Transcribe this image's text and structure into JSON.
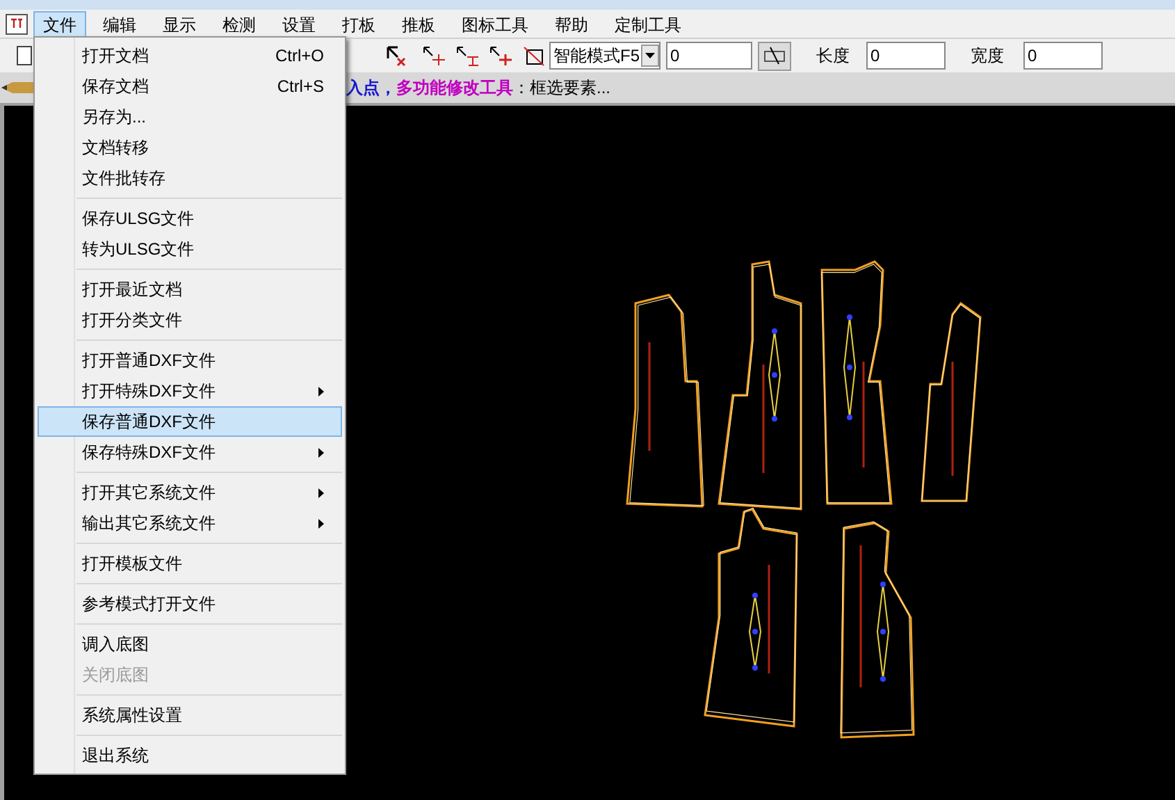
{
  "menu_bar": [
    {
      "label": "文件",
      "selected": true
    },
    {
      "label": "编辑",
      "selected": false
    },
    {
      "label": "显示",
      "selected": false
    },
    {
      "label": "检测",
      "selected": false
    },
    {
      "label": "设置",
      "selected": false
    },
    {
      "label": "打板",
      "selected": false
    },
    {
      "label": "推板",
      "selected": false
    },
    {
      "label": "图标工具",
      "selected": false
    },
    {
      "label": "帮助",
      "selected": false
    },
    {
      "label": "定制工具",
      "selected": false
    }
  ],
  "toolbar": {
    "mode_dropdown": "智能模式F5",
    "value_field": "0",
    "length_label": "长度",
    "length_field": "0",
    "width_label": "宽度",
    "width_field": "0"
  },
  "prompt_bar": [
    {
      "text": "入点，",
      "color": "#1a1ad0"
    },
    {
      "text": "多功能修改工具",
      "color": "#c000c0"
    },
    {
      "text": "：框选要素...",
      "color": "#000000"
    }
  ],
  "file_menu": [
    [
      {
        "label": "打开文档",
        "shortcut": "Ctrl+O",
        "submenu": false,
        "disabled": false,
        "selected": false
      },
      {
        "label": "保存文档",
        "shortcut": "Ctrl+S",
        "submenu": false,
        "disabled": false,
        "selected": false
      },
      {
        "label": "另存为...",
        "submenu": false,
        "disabled": false,
        "selected": false
      },
      {
        "label": "文档转移",
        "submenu": false,
        "disabled": false,
        "selected": false
      },
      {
        "label": "文件批转存",
        "submenu": false,
        "disabled": false,
        "selected": false
      }
    ],
    [
      {
        "label": "保存ULSG文件",
        "submenu": false,
        "disabled": false,
        "selected": false
      },
      {
        "label": "转为ULSG文件",
        "submenu": false,
        "disabled": false,
        "selected": false
      }
    ],
    [
      {
        "label": "打开最近文档",
        "submenu": false,
        "disabled": false,
        "selected": false
      },
      {
        "label": "打开分类文件",
        "submenu": false,
        "disabled": false,
        "selected": false
      }
    ],
    [
      {
        "label": "打开普通DXF文件",
        "submenu": false,
        "disabled": false,
        "selected": false
      },
      {
        "label": "打开特殊DXF文件",
        "submenu": true,
        "disabled": false,
        "selected": false
      },
      {
        "label": "保存普通DXF文件",
        "submenu": false,
        "disabled": false,
        "selected": true
      },
      {
        "label": "保存特殊DXF文件",
        "submenu": true,
        "disabled": false,
        "selected": false
      }
    ],
    [
      {
        "label": "打开其它系统文件",
        "submenu": true,
        "disabled": false,
        "selected": false
      },
      {
        "label": "输出其它系统文件",
        "submenu": true,
        "disabled": false,
        "selected": false
      }
    ],
    [
      {
        "label": "打开模板文件",
        "submenu": false,
        "disabled": false,
        "selected": false
      }
    ],
    [
      {
        "label": "参考模式打开文件",
        "submenu": false,
        "disabled": false,
        "selected": false
      }
    ],
    [
      {
        "label": "调入底图",
        "submenu": false,
        "disabled": false,
        "selected": false
      },
      {
        "label": "关闭底图",
        "submenu": false,
        "disabled": true,
        "selected": false
      }
    ],
    [
      {
        "label": "系统属性设置",
        "submenu": false,
        "disabled": false,
        "selected": false
      }
    ],
    [
      {
        "label": "退出系统",
        "submenu": false,
        "disabled": false,
        "selected": false
      }
    ]
  ]
}
